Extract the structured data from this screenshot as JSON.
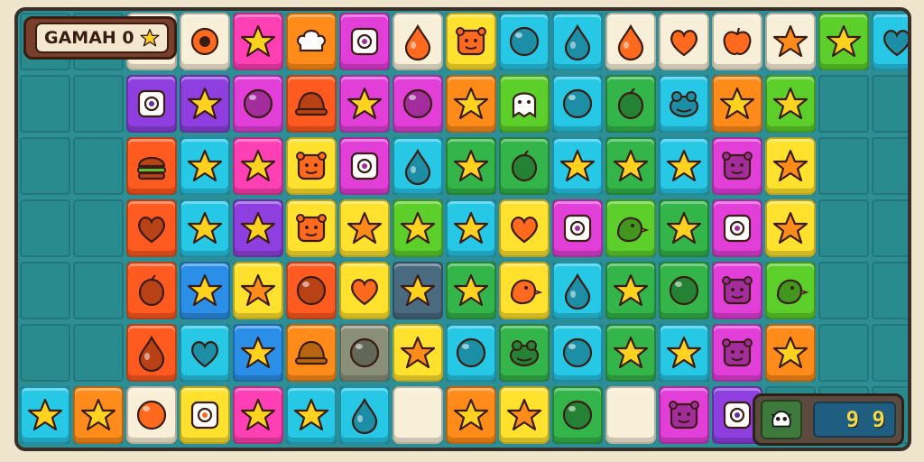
{
  "hud": {
    "score_label": "GAMAH 0",
    "score_star_icon": "star-icon",
    "moves_icon": "creature-icon",
    "moves_value": "9 9"
  },
  "colors": {
    "board": "#2d8f95",
    "empty_cell": "#2a8b8f",
    "star_yellow": "#ffd21f",
    "cream": "#f7efd8"
  },
  "palette": {
    "r": "#ff5a1f",
    "o": "#ff8c1a",
    "y": "#ffe12e",
    "g": "#5ccf2a",
    "G": "#33b54a",
    "c": "#27c7e6",
    "b": "#2b8fe8",
    "p": "#ff3fb4",
    "m": "#e23fd8",
    "v": "#8f3fe0",
    "w": "#f7efd8",
    "s": "#4a6a80",
    "n": "#8a8f7a"
  },
  "grid": [
    [
      null,
      null,
      [
        "w",
        ""
      ],
      [
        "w",
        "ring"
      ],
      [
        "p",
        "star"
      ],
      [
        "o",
        "chef"
      ],
      [
        "m",
        "face"
      ],
      [
        "w",
        "drop"
      ],
      [
        "y",
        "bear"
      ],
      [
        "c",
        "ball"
      ],
      [
        "c",
        "drop"
      ],
      [
        "w",
        "drop"
      ],
      [
        "w",
        "heart"
      ],
      [
        "w",
        "apple"
      ],
      [
        "w",
        "star"
      ],
      [
        "g",
        "star"
      ],
      [
        "c",
        "heart"
      ]
    ],
    [
      null,
      null,
      [
        "v",
        "face"
      ],
      [
        "v",
        "star"
      ],
      [
        "m",
        "ball"
      ],
      [
        "r",
        "hat"
      ],
      [
        "m",
        "star"
      ],
      [
        "m",
        "ball"
      ],
      [
        "o",
        "star"
      ],
      [
        "g",
        "ghost"
      ],
      [
        "c",
        "ball"
      ],
      [
        "G",
        "lemon"
      ],
      [
        "c",
        "frog"
      ],
      [
        "o",
        "star"
      ],
      [
        "g",
        "star"
      ],
      null,
      null
    ],
    [
      null,
      null,
      [
        "r",
        "burger"
      ],
      [
        "c",
        "star"
      ],
      [
        "p",
        "star"
      ],
      [
        "y",
        "bear"
      ],
      [
        "m",
        "face"
      ],
      [
        "c",
        "drop"
      ],
      [
        "G",
        "star"
      ],
      [
        "G",
        "lemon"
      ],
      [
        "c",
        "star"
      ],
      [
        "G",
        "star"
      ],
      [
        "c",
        "star"
      ],
      [
        "m",
        "bear"
      ],
      [
        "y",
        "star"
      ],
      null,
      null
    ],
    [
      null,
      null,
      [
        "r",
        "heart"
      ],
      [
        "c",
        "star"
      ],
      [
        "v",
        "star"
      ],
      [
        "y",
        "bear"
      ],
      [
        "y",
        "star"
      ],
      [
        "g",
        "star"
      ],
      [
        "c",
        "star"
      ],
      [
        "y",
        "heart"
      ],
      [
        "m",
        "face"
      ],
      [
        "g",
        "bird"
      ],
      [
        "G",
        "star"
      ],
      [
        "m",
        "face"
      ],
      [
        "y",
        "star"
      ],
      null,
      null
    ],
    [
      null,
      null,
      [
        "r",
        "lemon"
      ],
      [
        "b",
        "star"
      ],
      [
        "y",
        "star"
      ],
      [
        "r",
        "ball"
      ],
      [
        "y",
        "heart"
      ],
      [
        "s",
        "star"
      ],
      [
        "G",
        "star"
      ],
      [
        "y",
        "bird"
      ],
      [
        "c",
        "drop"
      ],
      [
        "G",
        "star"
      ],
      [
        "G",
        "ball"
      ],
      [
        "m",
        "bear"
      ],
      [
        "g",
        "bird"
      ],
      null,
      null
    ],
    [
      null,
      null,
      [
        "r",
        "drop"
      ],
      [
        "c",
        "heart"
      ],
      [
        "b",
        "star"
      ],
      [
        "o",
        "hat"
      ],
      [
        "n",
        "ball"
      ],
      [
        "y",
        "star"
      ],
      [
        "c",
        "ball"
      ],
      [
        "G",
        "frog"
      ],
      [
        "c",
        "ball"
      ],
      [
        "G",
        "star"
      ],
      [
        "c",
        "star"
      ],
      [
        "m",
        "bear"
      ],
      [
        "o",
        "star"
      ],
      null,
      null
    ],
    [
      [
        "c",
        "star"
      ],
      [
        "o",
        "star"
      ],
      [
        "w",
        "ball"
      ],
      [
        "y",
        "face"
      ],
      [
        "p",
        "star"
      ],
      [
        "c",
        "star"
      ],
      [
        "c",
        "drop"
      ],
      [
        "w",
        ""
      ],
      [
        "o",
        "star"
      ],
      [
        "y",
        "star"
      ],
      [
        "G",
        "ball"
      ],
      [
        "w",
        ""
      ],
      [
        "m",
        "bear"
      ],
      [
        "v",
        "face"
      ],
      null,
      null,
      null
    ]
  ]
}
